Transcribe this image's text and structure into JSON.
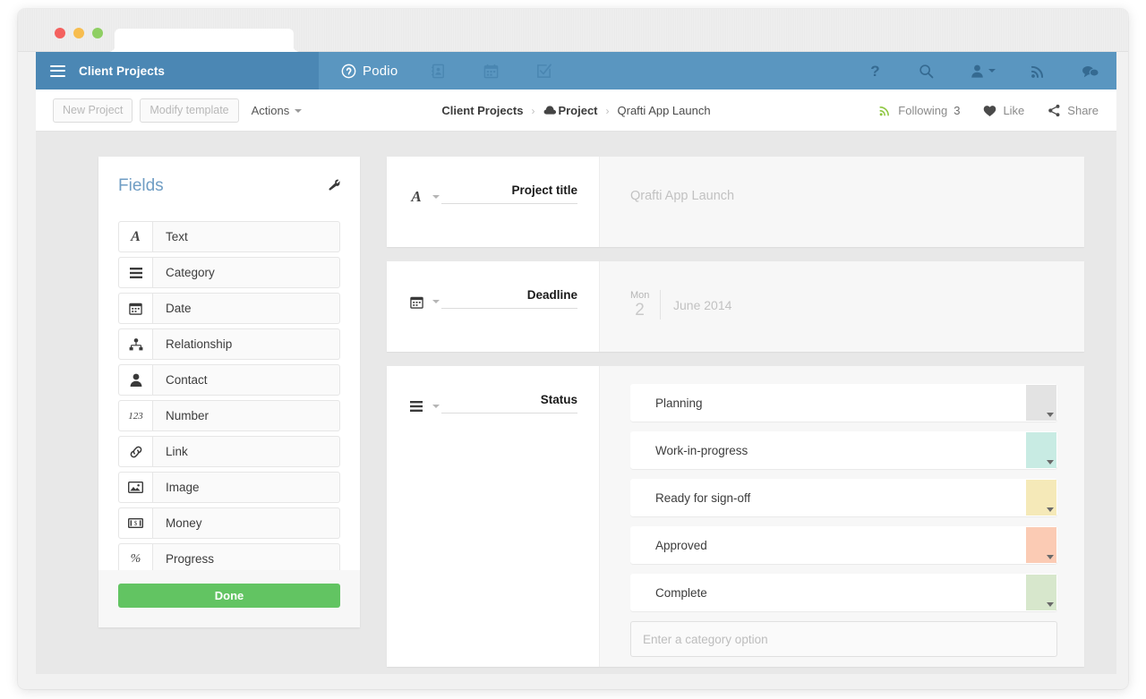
{
  "window": {
    "traffic_lights": [
      "close",
      "minimize",
      "maximize"
    ],
    "colors": {
      "navbar": "#5a96c0",
      "navbar_dark": "#4b87b4",
      "accent_green": "#62c462",
      "fields_title": "#6f9dc4"
    }
  },
  "navbar": {
    "menu_icon": "hamburger-icon",
    "app_title": "Client Projects",
    "brand": {
      "icon": "podio-logo-icon",
      "text": "Podio"
    },
    "mid_icons": [
      {
        "name": "contacts-icon"
      },
      {
        "name": "calendar-icon"
      },
      {
        "name": "tasks-icon"
      }
    ],
    "right_icons": [
      {
        "name": "help-icon",
        "glyph": "?"
      },
      {
        "name": "search-icon"
      },
      {
        "name": "user-menu-icon"
      },
      {
        "name": "activity-stream-icon"
      },
      {
        "name": "chat-icon"
      }
    ]
  },
  "toolbar": {
    "new_project_label": "New Project",
    "modify_template_label": "Modify template",
    "actions_label": "Actions",
    "breadcrumb": [
      {
        "label": "Client Projects",
        "bold": true,
        "icon": null
      },
      {
        "label": "Project",
        "bold": true,
        "icon": "cloud-icon"
      },
      {
        "label": "Qrafti App Launch",
        "bold": false,
        "icon": null
      }
    ],
    "separator": "›",
    "following_label": "Following",
    "following_count": "3",
    "like_label": "Like",
    "share_label": "Share"
  },
  "fields_panel": {
    "title": "Fields",
    "settings_icon": "wrench-icon",
    "items": [
      {
        "icon": "text-icon",
        "glyph": "A",
        "label": "Text"
      },
      {
        "icon": "category-icon",
        "glyph": "",
        "label": "Category"
      },
      {
        "icon": "date-icon",
        "glyph": "",
        "label": "Date"
      },
      {
        "icon": "relationship-icon",
        "glyph": "",
        "label": "Relationship"
      },
      {
        "icon": "contact-icon",
        "glyph": "",
        "label": "Contact"
      },
      {
        "icon": "number-icon",
        "glyph": "123",
        "label": "Number"
      },
      {
        "icon": "link-icon",
        "glyph": "",
        "label": "Link"
      },
      {
        "icon": "image-icon",
        "glyph": "",
        "label": "Image"
      },
      {
        "icon": "money-icon",
        "glyph": "",
        "label": "Money"
      },
      {
        "icon": "progress-icon",
        "glyph": "%",
        "label": "Progress"
      }
    ],
    "done_label": "Done"
  },
  "cards": {
    "title_field": {
      "type_icon": "text-icon",
      "type_glyph": "A",
      "label_value": "Project title",
      "value_placeholder": "Qrafti App Launch"
    },
    "deadline_field": {
      "type_icon": "date-icon",
      "label_value": "Deadline",
      "date_dow": "Mon",
      "date_day": "2",
      "date_rest": "June 2014"
    },
    "status_field": {
      "type_icon": "category-icon",
      "label_value": "Status",
      "options": [
        {
          "label": "Planning",
          "color": "#e3e3e3"
        },
        {
          "label": "Work-in-progress",
          "color": "#c8ebe3"
        },
        {
          "label": "Ready for sign-off",
          "color": "#f5e9b8"
        },
        {
          "label": "Approved",
          "color": "#fbcbb4"
        },
        {
          "label": "Complete",
          "color": "#d7e7cc"
        }
      ],
      "new_option_placeholder": "Enter a category option"
    }
  }
}
